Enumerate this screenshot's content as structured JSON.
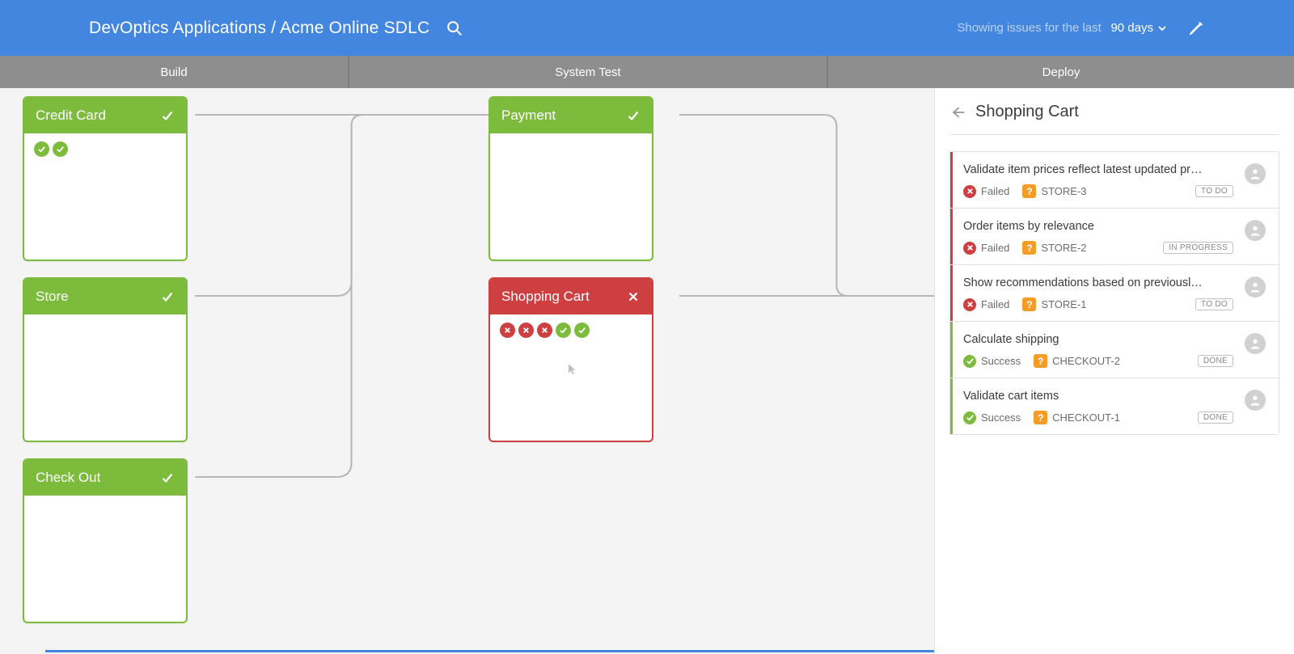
{
  "header": {
    "breadcrumb_app": "DevOptics Applications",
    "breadcrumb_sep": " / ",
    "breadcrumb_project": "Acme Online SDLC",
    "showing_label": "Showing issues for the last",
    "range": "90 days"
  },
  "tabs": {
    "build": "Build",
    "system_test": "System Test",
    "deploy": "Deploy"
  },
  "cards": {
    "credit": {
      "title": "Credit Card",
      "status": "ok",
      "dots": [
        "green",
        "green"
      ]
    },
    "payment": {
      "title": "Payment",
      "status": "ok",
      "dots": []
    },
    "store": {
      "title": "Store",
      "status": "ok",
      "dots": []
    },
    "shopping": {
      "title": "Shopping Cart",
      "status": "fail",
      "dots": [
        "red",
        "red",
        "red",
        "green",
        "green"
      ]
    },
    "checkout": {
      "title": "Check Out",
      "status": "ok",
      "dots": []
    }
  },
  "panel": {
    "title": "Shopping Cart",
    "issues": [
      {
        "title": "Validate item prices reflect latest updated pr…",
        "status": "Failed",
        "status_kind": "failed",
        "ticket": "STORE-3",
        "state": "TO DO"
      },
      {
        "title": "Order items by relevance",
        "status": "Failed",
        "status_kind": "failed",
        "ticket": "STORE-2",
        "state": "IN PROGRESS"
      },
      {
        "title": "Show recommendations based on previousl…",
        "status": "Failed",
        "status_kind": "failed",
        "ticket": "STORE-1",
        "state": "TO DO"
      },
      {
        "title": "Calculate shipping",
        "status": "Success",
        "status_kind": "success",
        "ticket": "CHECKOUT-2",
        "state": "DONE"
      },
      {
        "title": "Validate cart items",
        "status": "Success",
        "status_kind": "success",
        "ticket": "CHECKOUT-1",
        "state": "DONE"
      }
    ]
  }
}
